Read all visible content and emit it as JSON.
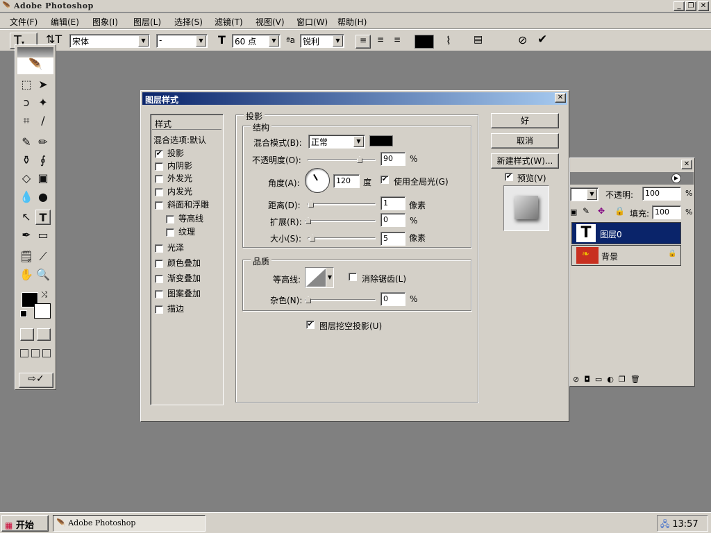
{
  "app": {
    "title": "Adobe Photoshop"
  },
  "menu": [
    "文件(F)",
    "编辑(E)",
    "图象(I)",
    "图层(L)",
    "选择(S)",
    "滤镜(T)",
    "视图(V)",
    "窗口(W)",
    "帮助(H)"
  ],
  "options": {
    "font_family": "宋体",
    "font_style": "-",
    "font_size": "60 点",
    "antialias": "锐利",
    "text_color": "#000000"
  },
  "dialog": {
    "title": "图层样式",
    "styles_header": "样式",
    "blend_options": "混合选项:默认",
    "styles": [
      {
        "label": "投影",
        "checked": true,
        "indent": false
      },
      {
        "label": "内阴影",
        "checked": false,
        "indent": false
      },
      {
        "label": "外发光",
        "checked": false,
        "indent": false
      },
      {
        "label": "内发光",
        "checked": false,
        "indent": false
      },
      {
        "label": "斜面和浮雕",
        "checked": false,
        "indent": false
      },
      {
        "label": "等高线",
        "checked": false,
        "indent": true
      },
      {
        "label": "纹理",
        "checked": false,
        "indent": true
      },
      {
        "label": "光泽",
        "checked": false,
        "indent": false
      },
      {
        "label": "颜色叠加",
        "checked": false,
        "indent": false
      },
      {
        "label": "渐变叠加",
        "checked": false,
        "indent": false
      },
      {
        "label": "图案叠加",
        "checked": false,
        "indent": false
      },
      {
        "label": "描边",
        "checked": false,
        "indent": false
      }
    ],
    "section_title": "投影",
    "structure": {
      "title": "结构",
      "blend_mode_label": "混合模式(B):",
      "blend_mode_value": "正常",
      "shadow_color": "#000000",
      "opacity_label": "不透明度(O):",
      "opacity_value": "90",
      "opacity_unit": "%",
      "angle_label": "角度(A):",
      "angle_value": "120",
      "angle_unit": "度",
      "global_light_label": "使用全局光(G)",
      "global_light_checked": true,
      "distance_label": "距离(D):",
      "distance_value": "1",
      "distance_unit": "像素",
      "spread_label": "扩展(R):",
      "spread_value": "0",
      "spread_unit": "%",
      "size_label": "大小(S):",
      "size_value": "5",
      "size_unit": "像素"
    },
    "quality": {
      "title": "品质",
      "contour_label": "等高线:",
      "antialias_label": "消除锯齿(L)",
      "noise_label": "杂色(N):",
      "noise_value": "0",
      "noise_unit": "%"
    },
    "knockout_label": "图层挖空投影(U)",
    "buttons": {
      "ok": "好",
      "cancel": "取消",
      "new_style": "新建样式(W)..."
    },
    "preview_label": "预览(V)"
  },
  "layers_panel": {
    "opacity_label": "不透明:",
    "opacity_value": "100",
    "fill_label": "填充:",
    "fill_value": "100",
    "pct": "%",
    "layers": [
      {
        "name": "图层0",
        "thumb": "T",
        "selected": true
      },
      {
        "name": "背景",
        "thumb": "",
        "selected": false,
        "locked": true
      }
    ]
  },
  "taskbar": {
    "start": "开始",
    "task": "Adobe Photoshop",
    "clock": "13:57"
  }
}
